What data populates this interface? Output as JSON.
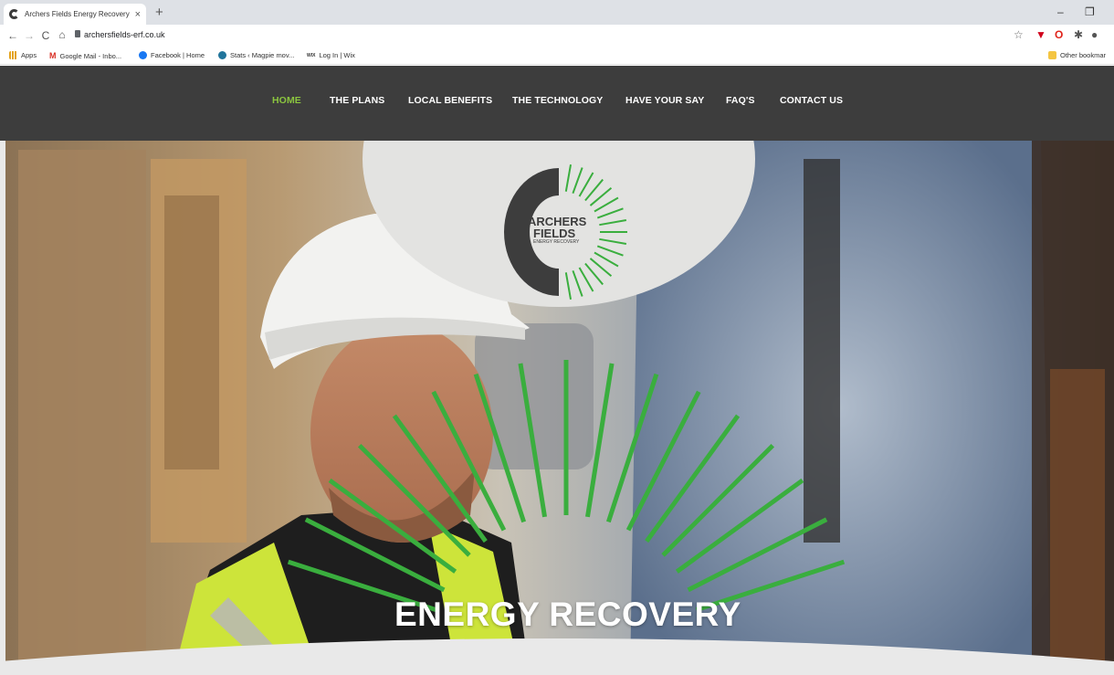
{
  "browser": {
    "tab_title": "Archers Fields Energy Recovery - ",
    "tab_close": "×",
    "new_tab": "+",
    "url": "archersfields-erf.co.uk",
    "nav": {
      "back": "←",
      "forward": "→",
      "reload": "C",
      "home": "⌂"
    },
    "window_controls": {
      "minimize": "–",
      "restore": "❐"
    },
    "bookmarks": [
      {
        "label": "Apps",
        "icon": "apps-icon",
        "color": "#e3a21a"
      },
      {
        "label": "Google Mail - Inbo...",
        "icon": "gmail-icon",
        "color": "#d93025"
      },
      {
        "label": "Facebook | Home",
        "icon": "facebook-icon",
        "color": "#1877f2"
      },
      {
        "label": "Stats ‹ Magpie mov...",
        "icon": "wordpress-icon",
        "color": "#21759b"
      },
      {
        "label": "Log In | Wix",
        "icon": "wix-icon",
        "color": "#333333"
      }
    ],
    "other_bookmarks": "Other bookmar"
  },
  "site": {
    "nav": [
      {
        "label": "HOME",
        "active": true
      },
      {
        "label": "THE PLANS",
        "active": false
      },
      {
        "label": "LOCAL BENEFITS",
        "active": false
      },
      {
        "label": "THE TECHNOLOGY",
        "active": false
      },
      {
        "label": "HAVE YOUR SAY",
        "active": false
      },
      {
        "label": "FAQ'S",
        "active": false
      },
      {
        "label": "CONTACT US",
        "active": false
      }
    ],
    "logo": {
      "line1": "ARCHERS",
      "line2": "FIELDS",
      "line3": "ENERGY RECOVERY"
    },
    "hero_title": "ENERGY RECOVERY",
    "colors": {
      "accent_green": "#3aae3e",
      "nav_active": "#8bc53f",
      "nav_bg": "#3d3d3d"
    }
  }
}
